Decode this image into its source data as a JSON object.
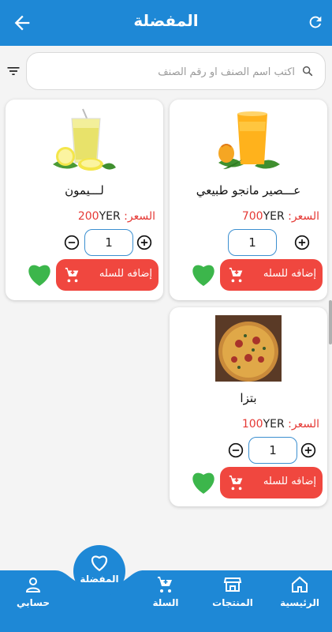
{
  "header": {
    "title": "المفضلة"
  },
  "search": {
    "placeholder": "اكتب اسم الصنف او رقم الصنف"
  },
  "products": [
    {
      "name": "عـــصير مانجو طبيعي",
      "price_label": "السعر:",
      "price_value": "700",
      "currency": "YER",
      "quantity": "1",
      "add_to_cart_label": "إضافه للسله",
      "image": "mango-juice"
    },
    {
      "name": "لـــيمون",
      "price_label": "السعر:",
      "price_value": "200",
      "currency": "YER",
      "quantity": "1",
      "add_to_cart_label": "إضافه للسله",
      "image": "lemon-juice"
    },
    {
      "name": "بتزا",
      "price_label": "السعر:",
      "price_value": "100",
      "currency": "YER",
      "quantity": "1",
      "add_to_cart_label": "إضافه للسله",
      "image": "pizza"
    }
  ],
  "bottom_nav": {
    "home": "الرئيسية",
    "products": "المنتجات",
    "cart": "السلة",
    "favorites": "المفضلة",
    "account": "حسابي"
  },
  "colors": {
    "primary": "#1e88d6",
    "cart_button": "#f0473f",
    "heart": "#3cb64b",
    "price_label": "#e53935"
  }
}
